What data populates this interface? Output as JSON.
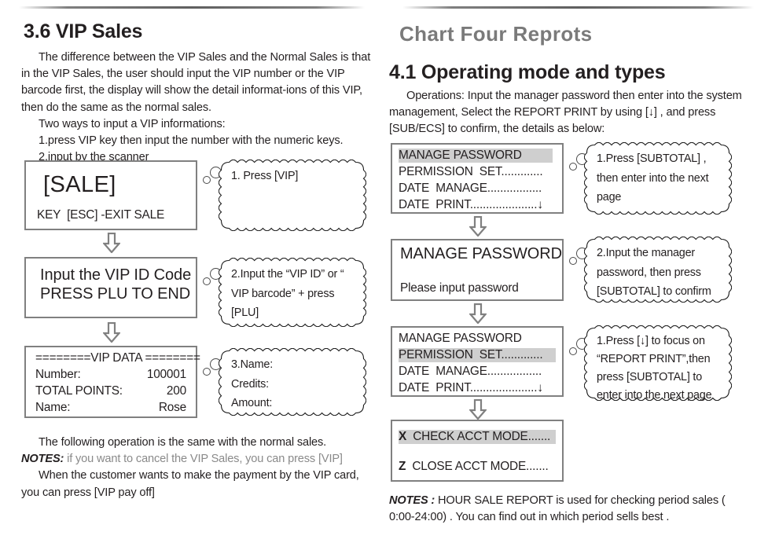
{
  "left": {
    "section_title": "3.6 VIP Sales",
    "intro_paragraphs": [
      "The difference between the VIP Sales and the Normal Sales is that in the VIP Sales, the user should input the VIP number or the VIP barcode first, the display will show the detail informat-ions of this VIP, then do the same as the normal sales.",
      "Two ways to input a VIP informations:",
      "1.press VIP key then input the number with the numeric keys.",
      "2.input by the scanner"
    ],
    "screens": [
      {
        "name": "sale-screen",
        "line1": "[SALE]",
        "line2": "KEY  [ESC] -EXIT SALE"
      },
      {
        "name": "input-vip-id-screen",
        "line1": "Input the VIP ID Code",
        "line2": "PRESS PLU TO END"
      },
      {
        "name": "vip-data-screen",
        "line1": "========VIP DATA ========",
        "row1_label": "Number:",
        "row1_value": "100001",
        "row2_label": "TOTAL POINTS:",
        "row2_value": "200",
        "row3_label": "Name:",
        "row3_value": "Rose"
      }
    ],
    "callouts": [
      "1. Press  [VIP]",
      "2.Input the “VIP ID” or “\nVIP barcode”  + press\n[PLU]",
      "3.Name:\n   Credits:\n   Amount:"
    ],
    "footer_lines": [
      "The following operation is the same with the normal sales.",
      "NOTES:",
      " if you want to cancel the VIP Sales, you can press  [VIP]",
      "When the customer wants to make the payment by the VIP card, you can press  [VIP pay off]"
    ]
  },
  "right": {
    "chapter_title": "Chart Four Reprots",
    "section_title": "4.1 Operating mode and types",
    "intro_paragraph": "Operations: Input the manager password then enter into the system management, Select the REPORT PRINT by using [↓] , and press [SUB/ECS] to confirm, the details as below:",
    "screens": [
      {
        "name": "menu-screen-1",
        "lines": [
          "MANAGE PASSWORD",
          "PERMISSION  SET.............",
          "DATE  MANAGE.................",
          "DATE  PRINT.....................↓"
        ],
        "highlight_index": 0
      },
      {
        "name": "manage-password-screen",
        "line1": "MANAGE PASSWORD",
        "line2": "Please input password"
      },
      {
        "name": "menu-screen-2",
        "lines": [
          "MANAGE PASSWORD",
          "PERMISSION  SET.............",
          "DATE  MANAGE.................",
          "DATE  PRINT.....................↓"
        ],
        "highlight_index": 1
      },
      {
        "name": "acct-mode-screen",
        "row1_key": "X",
        "row1_label": "CHECK ACCT MODE.......",
        "row2_key": "Z",
        "row2_label": "CLOSE ACCT MODE.......",
        "highlight_index": 0
      }
    ],
    "callouts": [
      "1.Press  [SUBTOTAL] ,\nthen enter into the next\npage",
      "2.Input the manager\npassword, then press\n[SUBTOTAL] to confirm",
      "1.Press  [↓] to focus on\n“REPORT PRINT”,then\npress  [SUBTOTAL]  to\nenter into the next page"
    ],
    "footer": {
      "lead": "NOTES :",
      "text": " HOUR SALE REPORT is used for checking period sales ( 0:00-24:00) . You can find out in which period sells best ."
    }
  },
  "colors": {
    "box_border": "#808080",
    "highlight": "#cfcfcf",
    "chapter_gray": "#7a7a7a",
    "text": "#231f20",
    "muted_text": "#8a8a8a"
  }
}
